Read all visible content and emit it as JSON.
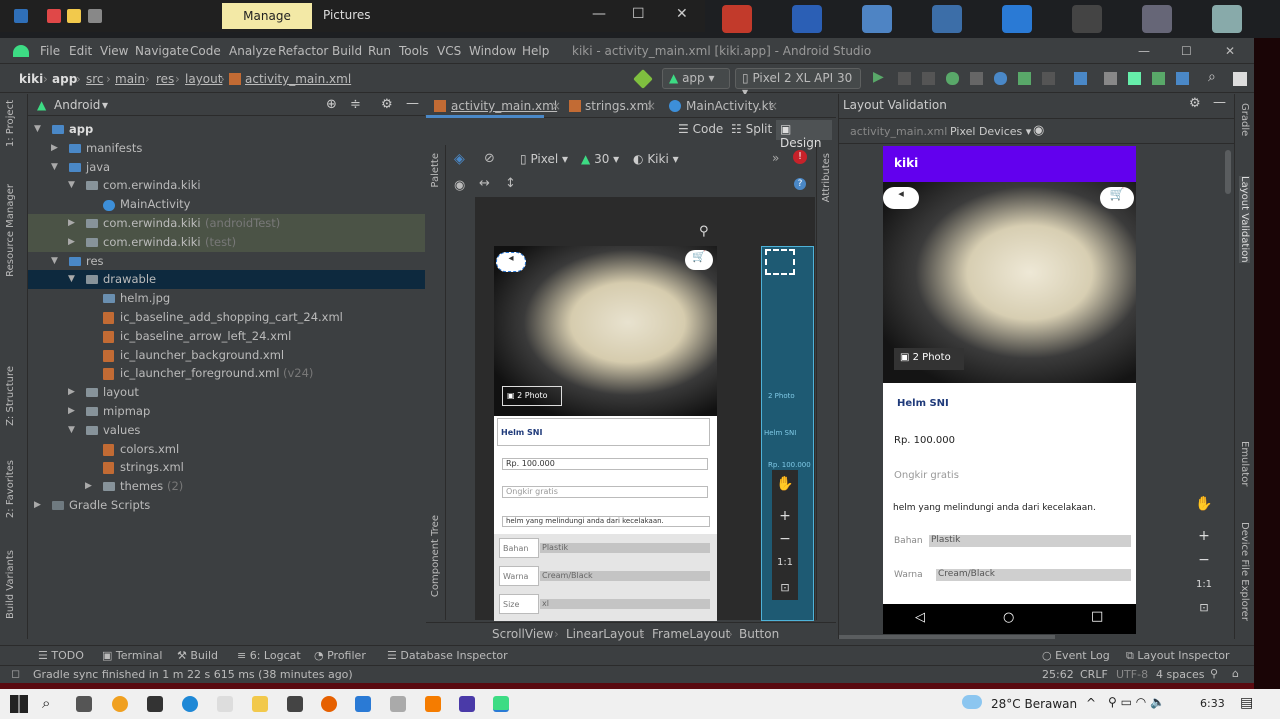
{
  "taskbar_top": {
    "manage_label": "Manage",
    "pictures_label": "Pictures",
    "minimize": "—",
    "maximize": "☐",
    "close": "✕"
  },
  "window": {
    "title": "kiki - activity_main.xml [kiki.app] - Android Studio"
  },
  "menu": [
    "File",
    "Edit",
    "View",
    "Navigate",
    "Code",
    "Analyze",
    "Refactor",
    "Build",
    "Run",
    "Tools",
    "VCS",
    "Window",
    "Help"
  ],
  "breadcrumb": [
    "kiki",
    "app",
    "src",
    "main",
    "res",
    "layout",
    "activity_main.xml"
  ],
  "run_config": {
    "module": "app",
    "device": "Pixel 2 XL API 30"
  },
  "left_stripe": [
    "1: Project",
    "Resource Manager",
    "Z: Structure",
    "2: Favorites",
    "Build Variants"
  ],
  "project": {
    "view": "Android",
    "tree": [
      {
        "label": "app",
        "suffix": ""
      },
      {
        "label": "manifests",
        "suffix": ""
      },
      {
        "label": "java",
        "suffix": ""
      },
      {
        "label": "com.erwinda.kiki",
        "suffix": ""
      },
      {
        "label": "MainActivity",
        "suffix": ""
      },
      {
        "label": "com.erwinda.kiki",
        "suffix": "(androidTest)"
      },
      {
        "label": "com.erwinda.kiki",
        "suffix": "(test)"
      },
      {
        "label": "res",
        "suffix": ""
      },
      {
        "label": "drawable",
        "suffix": ""
      },
      {
        "label": "helm.jpg",
        "suffix": ""
      },
      {
        "label": "ic_baseline_add_shopping_cart_24.xml",
        "suffix": ""
      },
      {
        "label": "ic_baseline_arrow_left_24.xml",
        "suffix": ""
      },
      {
        "label": "ic_launcher_background.xml",
        "suffix": ""
      },
      {
        "label": "ic_launcher_foreground.xml",
        "suffix": "(v24)"
      },
      {
        "label": "layout",
        "suffix": ""
      },
      {
        "label": "mipmap",
        "suffix": ""
      },
      {
        "label": "values",
        "suffix": ""
      },
      {
        "label": "colors.xml",
        "suffix": ""
      },
      {
        "label": "strings.xml",
        "suffix": ""
      },
      {
        "label": "themes",
        "suffix": "(2)"
      },
      {
        "label": "Gradle Scripts",
        "suffix": ""
      }
    ]
  },
  "editor_tabs": [
    "activity_main.xml",
    "strings.xml",
    "MainActivity.kt"
  ],
  "view_modes": [
    "Code",
    "Split",
    "Design"
  ],
  "design_toolbar": {
    "device": "Pixel",
    "api": "30",
    "theme": "Kiki"
  },
  "side_labels": {
    "palette": "Palette",
    "component_tree": "Component Tree",
    "attributes": "Attributes"
  },
  "preview": {
    "photo_label": "2 Photo",
    "product_name": "Helm SNI",
    "price": "Rp. 100.000",
    "shipping": "Ongkir gratis",
    "description": "helm yang melindungi anda dari kecelakaan.",
    "specs": [
      {
        "k": "Bahan",
        "v": "Plastik"
      },
      {
        "k": "Warna",
        "v": "Cream/Black"
      },
      {
        "k": "Size",
        "v": "xl"
      }
    ],
    "app_title": "kiki",
    "blueprint_photo": "2 Photo",
    "blueprint_name": "Helm SNI",
    "blueprint_price": "Rp. 100.000"
  },
  "zoom": {
    "one_to_one": "1:1"
  },
  "component_path": [
    "ScrollView",
    "LinearLayout",
    "FrameLayout",
    "Button"
  ],
  "layout_validation": {
    "title": "Layout Validation",
    "file": "activity_main.xml",
    "devices": "Pixel Devices"
  },
  "right_stripe": [
    "Gradle",
    "Layout Validation",
    "Emulator",
    "Device File Explorer"
  ],
  "bottom_tools": [
    "TODO",
    "Terminal",
    "Build",
    "6: Logcat",
    "Profiler",
    "Database Inspector"
  ],
  "bottom_tools_right": [
    "Event Log",
    "Layout Inspector"
  ],
  "status": {
    "message": "Gradle sync finished in 1 m 22 s 615 ms (38 minutes ago)",
    "position": "25:62",
    "line_sep": "CRLF",
    "encoding": "UTF-8",
    "indent": "4 spaces"
  },
  "system_tray": {
    "weather": "28°C Berawan",
    "time": "6:33"
  }
}
